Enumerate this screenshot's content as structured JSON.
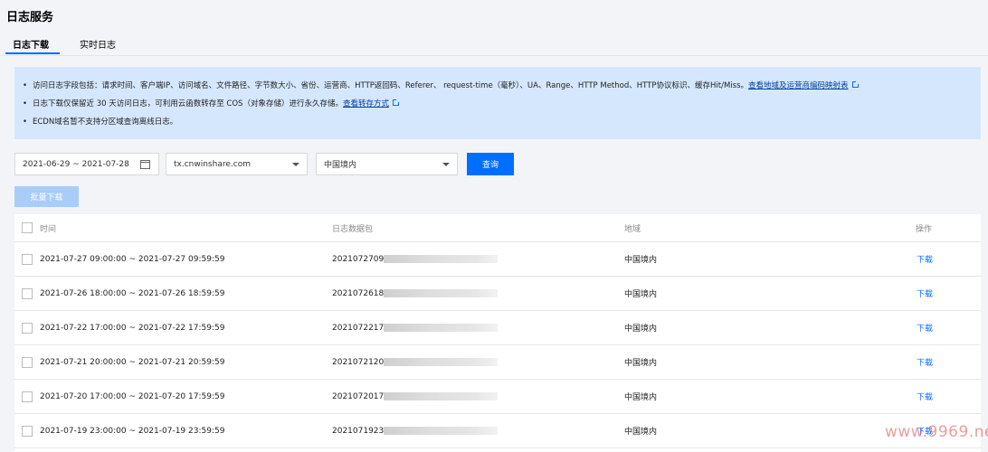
{
  "page": {
    "title": "日志服务"
  },
  "tabs": [
    {
      "label": "日志下载",
      "active": true
    },
    {
      "label": "实时日志",
      "active": false
    }
  ],
  "notice": {
    "line1": "访问日志字段包括：请求时间、客户端IP、访问域名、文件路径、字节数大小、省份、运营商、HTTP返回码、Referer、 request-time（毫秒）、UA、Range、HTTP Method、HTTP协议标识、缓存Hit/Miss。",
    "line1_link": "查看地域及运营商编码映射表",
    "line2": "日志下载仅保留近 30 天访问日志，可利用云函数转存至 COS（对象存储）进行永久存储。",
    "line2_link": "查看转存方式",
    "line3": "ECDN域名暂不支持分区域查询离线日志。"
  },
  "filters": {
    "date_range": "2021-06-29 ~ 2021-07-28",
    "domain": "tx.cnwinshare.com",
    "region": "中国境内",
    "query_label": "查询"
  },
  "batch_download_label": "批量下载",
  "table": {
    "headers": {
      "time": "时间",
      "package": "日志数据包",
      "region": "地域",
      "action": "操作"
    },
    "rows": [
      {
        "time": "2021-07-27 09:00:00 ~ 2021-07-27 09:59:59",
        "package": "2021072709",
        "region": "中国境内",
        "action": "下载"
      },
      {
        "time": "2021-07-26 18:00:00 ~ 2021-07-26 18:59:59",
        "package": "2021072618",
        "region": "中国境内",
        "action": "下载"
      },
      {
        "time": "2021-07-22 17:00:00 ~ 2021-07-22 17:59:59",
        "package": "2021072217",
        "region": "中国境内",
        "action": "下载"
      },
      {
        "time": "2021-07-21 20:00:00 ~ 2021-07-21 20:59:59",
        "package": "2021072120",
        "region": "中国境内",
        "action": "下载"
      },
      {
        "time": "2021-07-20 17:00:00 ~ 2021-07-20 17:59:59",
        "package": "2021072017",
        "region": "中国境内",
        "action": "下载"
      },
      {
        "time": "2021-07-19 23:00:00 ~ 2021-07-19 23:59:59",
        "package": "2021071923",
        "region": "中国境内",
        "action": "下载"
      }
    ]
  },
  "watermark": "www.9969.net",
  "colors": {
    "accent": "#006eff",
    "notice_bg": "#d5e7fd",
    "disabled_btn": "#a9ccfa"
  },
  "icons": {
    "calendar": "calendar-icon",
    "dropdown": "chevron-down-icon",
    "external": "external-link-icon"
  }
}
